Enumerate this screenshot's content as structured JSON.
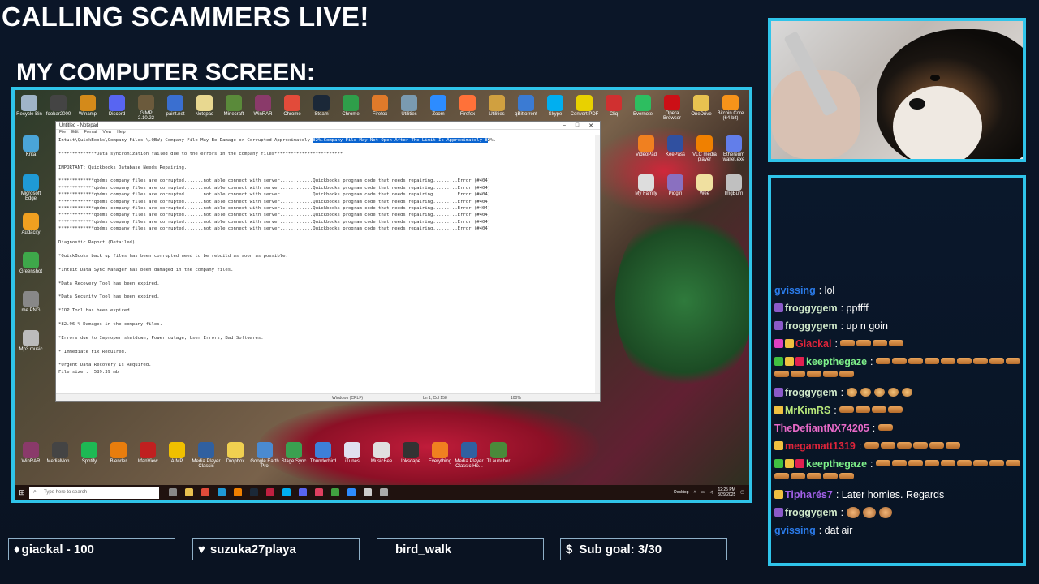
{
  "overlay": {
    "title": "CALLING SCAMMERS LIVE!",
    "subtitle": "MY COMPUTER SCREEN:"
  },
  "desktop": {
    "top_icons": [
      {
        "label": "Recycle Bin",
        "icon": "recycle-bin-icon",
        "color": "#9fb4c8"
      },
      {
        "label": "foobar2000",
        "icon": "foobar-icon",
        "color": "#444"
      },
      {
        "label": "Winamp",
        "icon": "winamp-icon",
        "color": "#d48a1a"
      },
      {
        "label": "Discord",
        "icon": "discord-icon",
        "color": "#5865f2"
      },
      {
        "label": "GIMP 2.10.22",
        "icon": "gimp-icon",
        "color": "#6b5a3c"
      },
      {
        "label": "paint.net",
        "icon": "paintnet-icon",
        "color": "#3a6fd0"
      },
      {
        "label": "Notepad",
        "icon": "notepad-icon",
        "color": "#e8d890"
      },
      {
        "label": "Minecraft",
        "icon": "minecraft-icon",
        "color": "#5a8a3a"
      },
      {
        "label": "WinRAR",
        "icon": "winrar-icon",
        "color": "#8a3a6a"
      },
      {
        "label": "Chrome",
        "icon": "chrome-icon",
        "color": "#e24b3a"
      },
      {
        "label": "Steam",
        "icon": "steam-icon",
        "color": "#1b2838"
      },
      {
        "label": "Chrome",
        "icon": "chrome-icon",
        "color": "#2f9e4a"
      },
      {
        "label": "Firefox",
        "icon": "firefox-icon",
        "color": "#e07a2a"
      },
      {
        "label": "Utilities",
        "icon": "utilities-icon",
        "color": "#7a9ab0"
      },
      {
        "label": "Zoom",
        "icon": "zoom-icon",
        "color": "#2d8cff"
      },
      {
        "label": "Firefox",
        "icon": "firefox-icon",
        "color": "#ff7139"
      },
      {
        "label": "Utilities",
        "icon": "eye-icon",
        "color": "#d0a040"
      },
      {
        "label": "qBittorrent",
        "icon": "qbittorrent-icon",
        "color": "#3b7bd3"
      },
      {
        "label": "Skype",
        "icon": "skype-icon",
        "color": "#00aff0"
      },
      {
        "label": "Convert PDF",
        "icon": "pdf-icon",
        "color": "#e8d100"
      },
      {
        "label": "Cliq",
        "icon": "app-icon",
        "color": "#d03030"
      },
      {
        "label": "Evernote",
        "icon": "evernote-icon",
        "color": "#2dbe60"
      },
      {
        "label": "Opera Browser",
        "icon": "opera-icon",
        "color": "#cc0f16"
      },
      {
        "label": "OneDrive",
        "icon": "folder-icon",
        "color": "#e8c250"
      },
      {
        "label": "Bitcoin Core (64-bit)",
        "icon": "bitcoin-icon",
        "color": "#f7931a"
      }
    ],
    "left_icons": [
      {
        "label": "Krita",
        "icon": "krita-icon",
        "color": "#4aa5d8"
      },
      {
        "label": "Microsoft Edge",
        "icon": "edge-icon",
        "color": "#1f9ad6"
      },
      {
        "label": "Audacity",
        "icon": "audacity-icon",
        "color": "#f0a020"
      },
      {
        "label": "Greenshot",
        "icon": "greenshot-icon",
        "color": "#3ea84a"
      },
      {
        "label": "me.PNG",
        "icon": "image-icon",
        "color": "#888"
      },
      {
        "label": "Mp3 music",
        "icon": "music-folder-icon",
        "color": "#bbb"
      }
    ],
    "right_icons": [
      {
        "label": "VideoPad",
        "icon": "videopad-icon",
        "color": "#f08020"
      },
      {
        "label": "KeePass",
        "icon": "keepass-icon",
        "color": "#3050a0"
      },
      {
        "label": "VLC media player",
        "icon": "vlc-icon",
        "color": "#f08000"
      },
      {
        "label": "Ethereum wallet.exe",
        "icon": "ethereum-icon",
        "color": "#627eea"
      },
      {
        "label": "My Family",
        "icon": "file-icon",
        "color": "#ddd"
      },
      {
        "label": "Pidgin",
        "icon": "pidgin-icon",
        "color": "#8a70c0"
      },
      {
        "label": "Wee",
        "icon": "file-icon",
        "color": "#f0e0a0"
      },
      {
        "label": "ImgBurn",
        "icon": "imgburn-icon",
        "color": "#c0c0c0"
      }
    ],
    "bottom_icons": [
      {
        "label": "WinRAR",
        "icon": "winrar-icon",
        "color": "#8a3a6a"
      },
      {
        "label": "MediaMon...",
        "icon": "media-icon",
        "color": "#444"
      },
      {
        "label": "Spotify",
        "icon": "spotify-icon",
        "color": "#1db954"
      },
      {
        "label": "Blender",
        "icon": "blender-icon",
        "color": "#e87d0d"
      },
      {
        "label": "IrfanView",
        "icon": "irfanview-icon",
        "color": "#c02020"
      },
      {
        "label": "AIMP",
        "icon": "aimp-icon",
        "color": "#f0c000"
      },
      {
        "label": "Media Player Classic",
        "icon": "mpc-icon",
        "color": "#3060a0"
      },
      {
        "label": "Dropbox",
        "icon": "dropbox-icon",
        "color": "#f0d050"
      },
      {
        "label": "Google Earth Pro",
        "icon": "google-earth-icon",
        "color": "#4a8ad0"
      },
      {
        "label": "Stage Sync",
        "icon": "stagesync-icon",
        "color": "#3aa050"
      },
      {
        "label": "Thunderbird",
        "icon": "thunderbird-icon",
        "color": "#3d7fd8"
      },
      {
        "label": "iTunes",
        "icon": "itunes-icon",
        "color": "#e0e0f0"
      },
      {
        "label": "MusicBee",
        "icon": "musicbee-icon",
        "color": "#e0e0e0"
      },
      {
        "label": "Inkscape",
        "icon": "inkscape-icon",
        "color": "#333"
      },
      {
        "label": "Everything",
        "icon": "everything-icon",
        "color": "#f08020"
      },
      {
        "label": "Media Player Classic Ho...",
        "icon": "mpc-icon",
        "color": "#3060a0"
      },
      {
        "label": "TLauncher",
        "icon": "tlauncher-icon",
        "color": "#4a8a3a"
      }
    ]
  },
  "notepad": {
    "title": "Untitled - Notepad",
    "menu": [
      "File",
      "Edit",
      "Format",
      "View",
      "Help"
    ],
    "line1_pre": "Intuit\\QuickBooks\\Company Files \\.QBW; Company File May Be Damage or Corrupted Approximately ",
    "line1_sel": "82%.Company File May Not Open After The Limit Is Approximately 8",
    "line1_post": "2%.",
    "lines": [
      "",
      "**************Data syncronization failed due to the errors in the company files*************************",
      "",
      "IMPORTANT: Quickbooks Database Needs Repairing.",
      "",
      "*************qbdms company files are corrupted.......not able connect with server............Quickbooks program code that needs repairing.........Error (#404)",
      "*************qbdms company files are corrupted.......not able connect with server............Quickbooks program code that needs repairing.........Error (#404)",
      "*************qbdms company files are corrupted.......not able connect with server............Quickbooks program code that needs repairing.........Error (#404)",
      "*************qbdms company files are corrupted.......not able connect with server............Quickbooks program code that needs repairing.........Error (#404)",
      "*************qbdms company files are corrupted.......not able connect with server............Quickbooks program code that needs repairing.........Error (#404)",
      "*************qbdms company files are corrupted.......not able connect with server............Quickbooks program code that needs repairing.........Error (#404)",
      "*************qbdms company files are corrupted.......not able connect with server............Quickbooks program code that needs repairing.........Error (#404)",
      "*************qbdms company files are corrupted.......not able connect with server............Quickbooks program code that needs repairing.........Error (#404)",
      "",
      "Diagnostic Report (Detailed)",
      "",
      "*QuickBooks back up files has been corrupted need to be rebuild as soon as possible.",
      "",
      "*Intuit Data Sync Manager has been damaged in the company files.",
      "",
      "*Data Recovery Tool has been expired.",
      "",
      "*Data Security Tool has been expired.",
      "",
      "*IOP Tool has been expired.",
      "",
      "*82.96 % Damages in the company files.",
      "",
      "*Errors due to Improper shutdown, Power outage, User Errors, Bad Softwares.",
      "",
      "* Immediate Fix Required.",
      "",
      "*Urgent Data Recovery Is Required.",
      "File size :  589.39 mb"
    ],
    "status": {
      "encoding": "Windows (CRLF)",
      "position": "Ln 1, Col 158",
      "zoom": "100%"
    }
  },
  "taskbar": {
    "search_placeholder": "Type here to search",
    "desktop_label": "Desktop",
    "time": "12:25 PM",
    "date": "8/29/2025"
  },
  "chat": [
    {
      "user": "gvissing",
      "color": "#2a7ae8",
      "text": "lol",
      "badges": [],
      "emotes": ""
    },
    {
      "user": "froggygem",
      "color": "#cfe8c9",
      "text": "ppffff",
      "badges": [
        "#8a5ac8"
      ],
      "emotes": ""
    },
    {
      "user": "froggygem",
      "color": "#cfe8c9",
      "text": "up n goin",
      "badges": [
        "#8a5ac8"
      ],
      "emotes": ""
    },
    {
      "user": "Giackal",
      "color": "#e0243a",
      "text": "",
      "badges": [
        "#e040c0",
        "#f0c040"
      ],
      "emotes": "em4"
    },
    {
      "user": "keepthegaze",
      "color": "#7ef08a",
      "text": "",
      "badges": [
        "#40c040",
        "#f0c040",
        "#e02050"
      ],
      "emotes": "em14"
    },
    {
      "user": "froggygem",
      "color": "#cfe8c9",
      "text": "",
      "badges": [
        "#8a5ac8"
      ],
      "emotes": "em2x5"
    },
    {
      "user": "MrKimRS",
      "color": "#b8e87a",
      "text": "",
      "badges": [
        "#f0c040"
      ],
      "emotes": "em4"
    },
    {
      "user": "TheDefiantNX74205",
      "color": "#e86ac8",
      "text": "",
      "badges": [],
      "emotes": "em1"
    },
    {
      "user": "megamatt1319",
      "color": "#e0243a",
      "text": "",
      "badges": [
        "#f0c040"
      ],
      "emotes": "em6"
    },
    {
      "user": "keepthegaze",
      "color": "#7ef08a",
      "text": "",
      "badges": [
        "#40c040",
        "#f0c040",
        "#e02050"
      ],
      "emotes": "em14"
    },
    {
      "user": "Tipharés7",
      "color": "#a260e8",
      "text": "Later homies. Regards",
      "badges": [
        "#f0c040"
      ],
      "emotes": ""
    },
    {
      "user": "froggygem",
      "color": "#cfe8c9",
      "text": "",
      "badges": [
        "#8a5ac8"
      ],
      "emotes": "em3x3"
    },
    {
      "user": "gvissing",
      "color": "#2a7ae8",
      "text": "dat air",
      "badges": [],
      "emotes": ""
    }
  ],
  "bottom_bar": [
    {
      "icon": "diamond-icon",
      "glyph": "♦",
      "label": "giackal - 100"
    },
    {
      "icon": "heart-icon",
      "glyph": "♥",
      "label": "suzuka27playa"
    },
    {
      "icon": "",
      "glyph": "",
      "label": "bird_walk"
    },
    {
      "icon": "dollar-icon",
      "glyph": "$",
      "label": "Sub goal: 3/30"
    }
  ],
  "colors": {
    "frame": "#2fc4ea",
    "accent_blue": "#0a64d0"
  }
}
